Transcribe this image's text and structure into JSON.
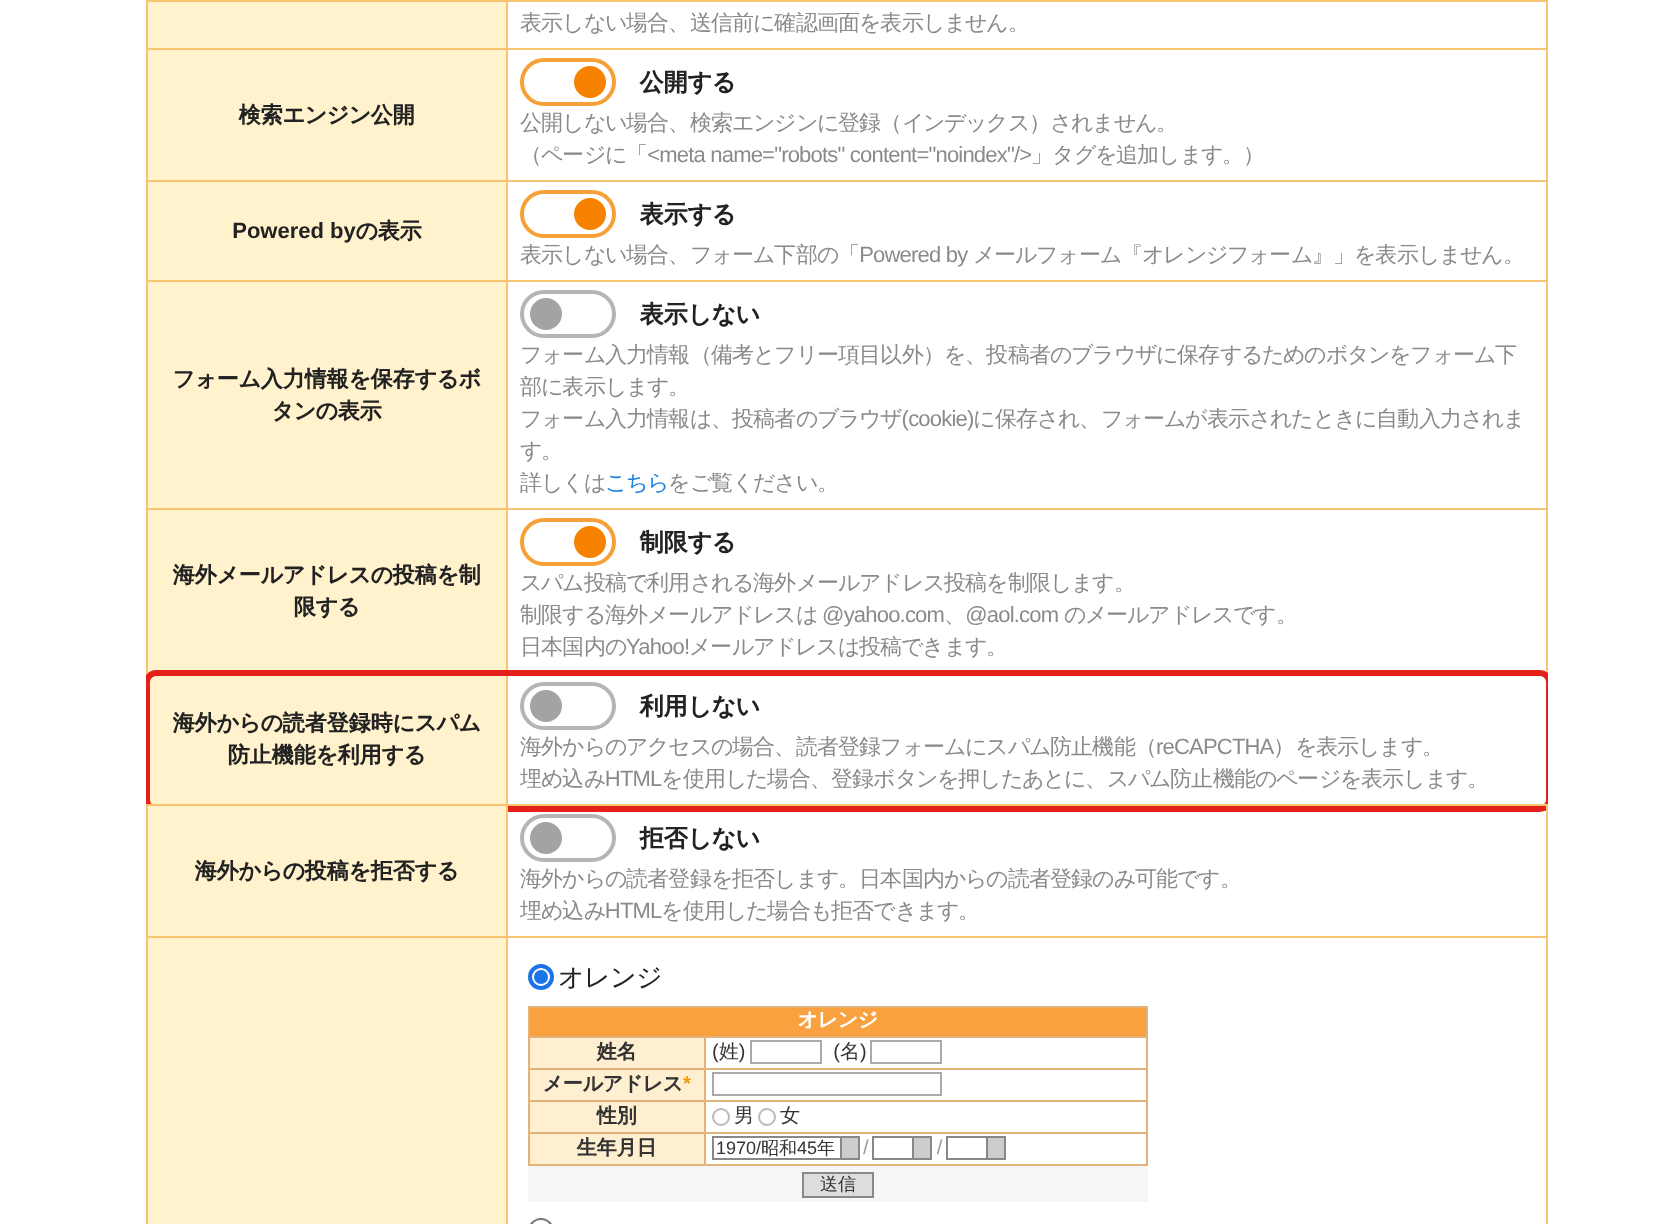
{
  "settings": [
    {
      "description": [
        {
          "kind": "text",
          "text": "表示しない場合、送信前に確認画面を表示しません。"
        }
      ],
      "highlighted": false
    },
    {
      "label": "検索エンジン公開",
      "toggle_on": true,
      "value": "公開する",
      "description": [
        {
          "kind": "text",
          "text": "公開しない場合、検索エンジンに登録（インデックス）されません。"
        },
        {
          "kind": "text",
          "text": "（ページに「<meta name=\"robots\" content=\"noindex\"/>」タグを追加します。）"
        }
      ],
      "highlighted": false
    },
    {
      "label": "Powered byの表示",
      "toggle_on": true,
      "value": "表示する",
      "description": [
        {
          "kind": "text",
          "text": "表示しない場合、フォーム下部の「Powered by メールフォーム『オレンジフォーム』」を表示しません。"
        }
      ],
      "highlighted": false
    },
    {
      "label": "フォーム入力情報を保存するボタンの表示",
      "toggle_on": false,
      "value": "表示しない",
      "description": [
        {
          "kind": "text",
          "text": "フォーム入力情報（備考とフリー項目以外）を、投稿者のブラウザに保存するためのボタンをフォーム下部に表示します。"
        },
        {
          "kind": "text",
          "text": "フォーム入力情報は、投稿者のブラウザ(cookie)に保存され、フォームが表示されたときに自動入力されます。"
        },
        {
          "kind": "link",
          "before": "詳しくは",
          "link": "こちら",
          "after": "をご覧ください。"
        }
      ],
      "highlighted": false
    },
    {
      "label": "海外メールアドレスの投稿を制限する",
      "toggle_on": true,
      "value": "制限する",
      "description": [
        {
          "kind": "text",
          "text": "スパム投稿で利用される海外メールアドレス投稿を制限します。"
        },
        {
          "kind": "text",
          "text": "制限する海外メールアドレスは @yahoo.com、@aol.com のメールアドレスです。"
        },
        {
          "kind": "text",
          "text": "日本国内のYahoo!メールアドレスは投稿できます。"
        }
      ],
      "highlighted": false
    },
    {
      "label": "海外からの読者登録時にスパム防止機能を利用する",
      "toggle_on": false,
      "value": "利用しない",
      "description": [
        {
          "kind": "text",
          "text": "海外からのアクセスの場合、読者登録フォームにスパム防止機能（reCAPCTHA）を表示します。"
        },
        {
          "kind": "text",
          "text": "埋め込みHTMLを使用した場合、登録ボタンを押したあとに、スパム防止機能のページを表示します。"
        }
      ],
      "highlighted": true
    },
    {
      "label": "海外からの投稿を拒否する",
      "toggle_on": false,
      "value": "拒否しない",
      "description": [
        {
          "kind": "text",
          "text": "海外からの読者登録を拒否します。日本国内からの読者登録のみ可能です。"
        },
        {
          "kind": "text",
          "text": "埋め込みHTMLを使用した場合も拒否できます。"
        }
      ],
      "highlighted": false
    }
  ],
  "design_options": [
    {
      "label": "オレンジ",
      "selected": true
    },
    {
      "selected": false
    }
  ],
  "preview": {
    "title": "オレンジ",
    "rows": [
      {
        "kind": "name",
        "label": "姓名",
        "first": "(姓)",
        "second": "(名)"
      },
      {
        "kind": "email",
        "label": "メールアドレス",
        "required": "*"
      },
      {
        "kind": "gender",
        "label": "性別",
        "options": [
          {
            "label": "男",
            "selected": false
          },
          {
            "label": "女",
            "selected": false
          }
        ]
      },
      {
        "kind": "birthday",
        "label": "生年月日",
        "year": "1970/昭和45年",
        "separator": "/"
      }
    ],
    "submit": "送信"
  }
}
